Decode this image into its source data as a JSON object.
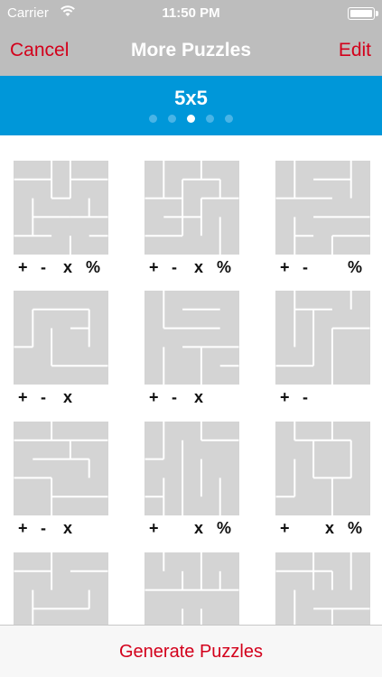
{
  "status": {
    "carrier": "Carrier",
    "time": "11:50 PM"
  },
  "nav": {
    "title": "More Puzzles",
    "cancel": "Cancel",
    "edit": "Edit"
  },
  "size": {
    "title": "5x5",
    "pages": 5,
    "active_page": 2
  },
  "ops_glyphs": [
    "+",
    "-",
    "x",
    "%"
  ],
  "puzzles": [
    {
      "ops": [
        true,
        true,
        true,
        true
      ]
    },
    {
      "ops": [
        true,
        true,
        true,
        true
      ]
    },
    {
      "ops": [
        true,
        true,
        false,
        true
      ]
    },
    {
      "ops": [
        true,
        true,
        true,
        false
      ]
    },
    {
      "ops": [
        true,
        true,
        true,
        false
      ]
    },
    {
      "ops": [
        true,
        true,
        false,
        false
      ]
    },
    {
      "ops": [
        true,
        true,
        true,
        false
      ]
    },
    {
      "ops": [
        true,
        false,
        true,
        true
      ]
    },
    {
      "ops": [
        true,
        false,
        true,
        true
      ]
    },
    {
      "ops": [
        true,
        true,
        true,
        true
      ]
    },
    {
      "ops": [
        true,
        true,
        true,
        true
      ]
    },
    {
      "ops": [
        true,
        true,
        true,
        true
      ]
    }
  ],
  "bottom": {
    "generate": "Generate Puzzles"
  },
  "colors": {
    "accent": "#d3001b",
    "header_blue": "#0097d9",
    "bar_gray": "#bdbdbd",
    "cell_gray": "#d4d4d4"
  },
  "icons": {
    "wifi": "wifi-icon",
    "battery": "battery-icon"
  }
}
